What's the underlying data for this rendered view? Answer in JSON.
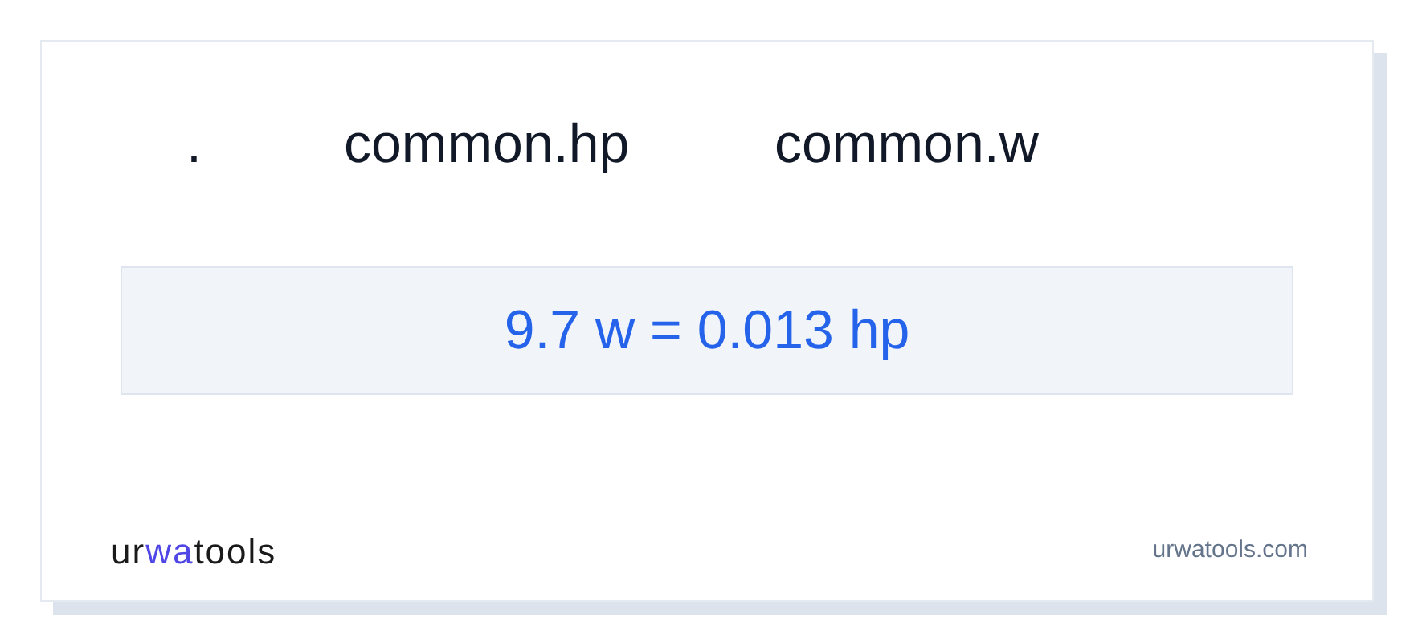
{
  "header": [
    ".",
    "common.hp",
    "common.w"
  ],
  "result": "9.7 w = 0.013 hp",
  "logo": [
    {
      "text": "ur",
      "accent": false
    },
    {
      "text": "wa",
      "accent": true
    },
    {
      "text": "tools",
      "accent": false
    }
  ],
  "site": "urwatools.com"
}
